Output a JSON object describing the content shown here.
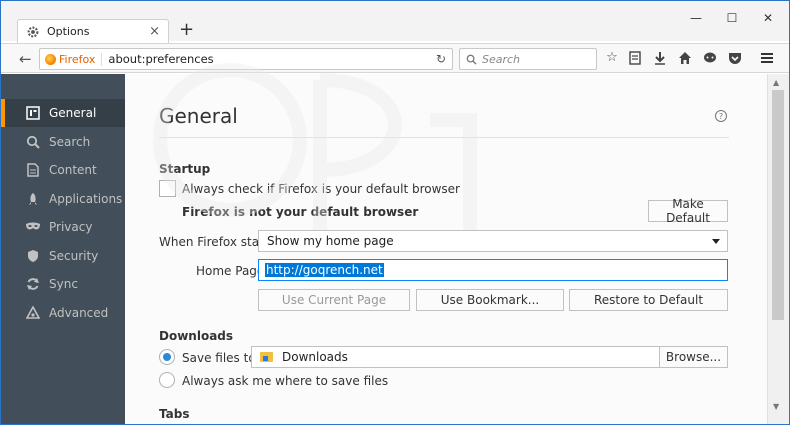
{
  "tab": {
    "title": "Options",
    "close": "×"
  },
  "newtab": "+",
  "window_controls": {
    "minimize": "—",
    "maximize": "☐",
    "close": "✕"
  },
  "navbar": {
    "back": "←",
    "identity": "Firefox",
    "url": "about:preferences",
    "reload": "↻",
    "search_placeholder": "Search"
  },
  "toolbar_icons": [
    "star-icon",
    "reading-list-icon",
    "download-icon",
    "home-icon",
    "chat-icon",
    "pocket-icon",
    "menu-icon"
  ],
  "sidebar": {
    "items": [
      {
        "label": "General",
        "icon": "general-icon",
        "selected": true
      },
      {
        "label": "Search",
        "icon": "search-icon"
      },
      {
        "label": "Content",
        "icon": "content-icon"
      },
      {
        "label": "Applications",
        "icon": "applications-icon"
      },
      {
        "label": "Privacy",
        "icon": "privacy-mask-icon"
      },
      {
        "label": "Security",
        "icon": "security-shield-icon"
      },
      {
        "label": "Sync",
        "icon": "sync-icon"
      },
      {
        "label": "Advanced",
        "icon": "advanced-icon"
      }
    ]
  },
  "main": {
    "title": "General",
    "help": "?",
    "startup": {
      "heading": "Startup",
      "default_check_label": "Always check if Firefox is your default browser",
      "not_default_text": "Firefox is not your default browser",
      "make_default_button": "Make Default",
      "when_starts_label": "When Firefox starts:",
      "when_starts_value": "Show my home page",
      "home_page_label": "Home Page:",
      "home_page_value": "http://goqrench.net",
      "use_current_button": "Use Current Page",
      "use_bookmark_button": "Use Bookmark...",
      "restore_default_button": "Restore to Default"
    },
    "downloads": {
      "heading": "Downloads",
      "save_files_label": "Save files to",
      "save_files_path": "Downloads",
      "browse_button": "Browse...",
      "always_ask_label": "Always ask me where to save files"
    },
    "tabs_heading": "Tabs"
  },
  "colors": {
    "accent": "#ff9500",
    "sidebar": "#424f5a",
    "selection": "#0078d7"
  }
}
